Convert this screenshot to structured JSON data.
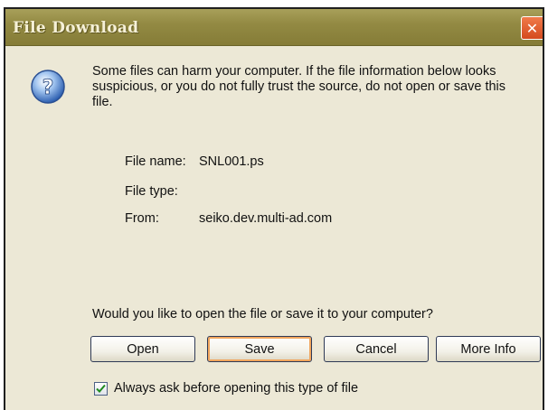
{
  "dialog": {
    "title": "File Download",
    "close_symbol": "✕"
  },
  "message": "Some files can harm your computer. If the file information below looks suspicious, or you do not fully trust the source, do not open or save this file.",
  "file_info": {
    "name_label": "File name:",
    "name_value": "SNL001.ps",
    "type_label": "File type:",
    "type_value": "",
    "from_label": "From:",
    "from_value": "seiko.dev.multi-ad.com"
  },
  "question": "Would you like to open the file or save it to your computer?",
  "buttons": {
    "open": "Open",
    "save": "Save",
    "cancel": "Cancel",
    "more_info": "More Info"
  },
  "checkbox": {
    "label": "Always ask before opening this type of file",
    "checked": true
  },
  "icons": {
    "help": "help-icon",
    "close": "close-icon",
    "check": "checkmark-icon"
  },
  "colors": {
    "titlebar": "#938a43",
    "dialog_bg": "#ece8d6",
    "close_button": "#d44a1e",
    "default_button_highlight": "#f1a65e"
  }
}
